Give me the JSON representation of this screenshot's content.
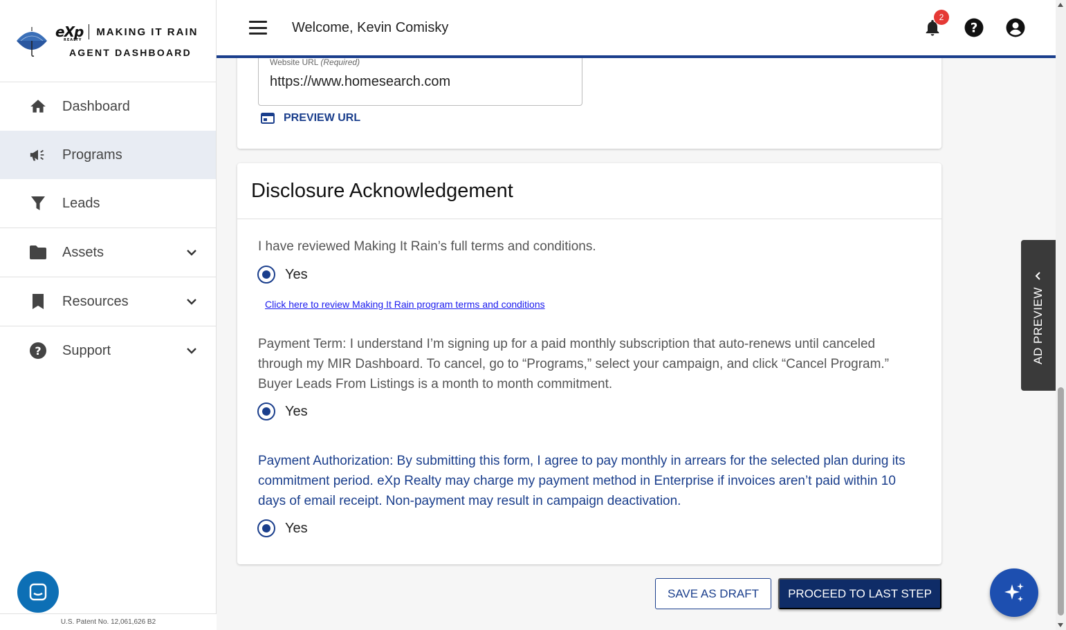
{
  "brand": {
    "exp": "eXp",
    "exp_sub": "REALTY",
    "name": "MAKING IT RAIN",
    "subtitle": "AGENT DASHBOARD"
  },
  "sidebar": {
    "items": [
      {
        "label": "Dashboard",
        "icon": "home-icon"
      },
      {
        "label": "Programs",
        "icon": "megaphone-icon",
        "active": true
      },
      {
        "label": "Leads",
        "icon": "filter-icon"
      },
      {
        "label": "Assets",
        "icon": "folder-icon",
        "expandable": true
      },
      {
        "label": "Resources",
        "icon": "bookmark-icon",
        "expandable": true
      },
      {
        "label": "Support",
        "icon": "help-circle-icon",
        "expandable": true
      }
    ],
    "patent": "U.S. Patent No. 12,061,626 B2"
  },
  "header": {
    "welcome": "Welcome, Kevin Comisky",
    "notification_count": "2"
  },
  "website": {
    "label": "Website URL",
    "label_hint": "(Required)",
    "value": "https://www.homesearch.com",
    "preview_label": "PREVIEW URL"
  },
  "disclosure": {
    "title": "Disclosure Acknowledgement",
    "q1": "I have reviewed Making It Rain’s full terms and conditions.",
    "q1_answer": "Yes",
    "terms_link": "Click here to review Making It Rain program terms and conditions",
    "q2": "Payment Term: I understand I’m signing up for a paid monthly subscription that auto-renews until canceled through my MIR Dashboard. To cancel, go to “Programs,” select your campaign, and click “Cancel Program.” Buyer Leads From Listings is a month to month commitment.",
    "q2_answer": "Yes",
    "q3": "Payment Authorization: By submitting this form, I agree to pay monthly in arrears for the selected plan during its commitment period. eXp Realty may charge my payment method in Enterprise if invoices aren’t paid within 10 days of email receipt. Non-payment may result in campaign deactivation.",
    "q3_answer": "Yes"
  },
  "actions": {
    "save_draft": "SAVE AS DRAFT",
    "proceed": "PROCEED TO LAST STEP"
  },
  "ad_preview": {
    "label": "AD PREVIEW"
  },
  "colors": {
    "primary": "#1a3e8c",
    "primary_dark": "#0f2c67",
    "badge": "#e53935"
  }
}
